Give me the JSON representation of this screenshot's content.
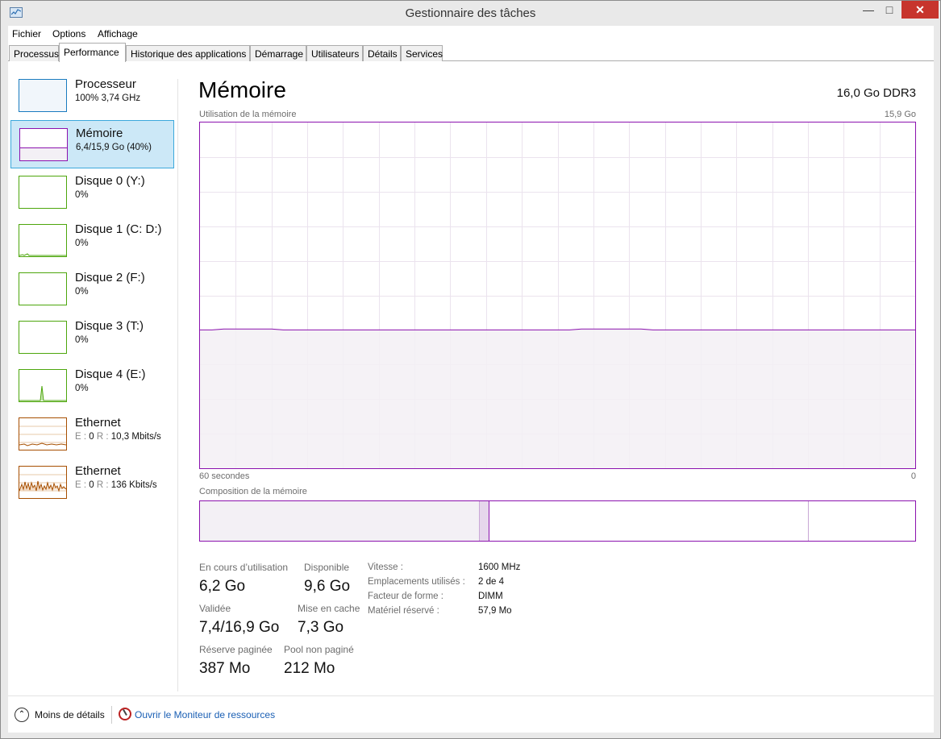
{
  "window": {
    "title": "Gestionnaire des tâches"
  },
  "menu": [
    {
      "label": "Fichier"
    },
    {
      "label": "Options"
    },
    {
      "label": "Affichage"
    }
  ],
  "tabs": [
    {
      "label": "Processus",
      "active": false
    },
    {
      "label": "Performance",
      "active": true
    },
    {
      "label": "Historique des applications",
      "active": false
    },
    {
      "label": "Démarrage",
      "active": false
    },
    {
      "label": "Utilisateurs",
      "active": false
    },
    {
      "label": "Détails",
      "active": false
    },
    {
      "label": "Services",
      "active": false
    }
  ],
  "sidebar": [
    {
      "title": "Processeur",
      "subtitle": "100% 3,74 GHz",
      "color": "#1a7bbf",
      "selected": false
    },
    {
      "title": "Mémoire",
      "subtitle": "6,4/15,9 Go (40%)",
      "color": "#8b12ae",
      "selected": true
    },
    {
      "title": "Disque 0 (Y:)",
      "subtitle": "0%",
      "color": "#4da60c",
      "selected": false
    },
    {
      "title": "Disque 1 (C: D:)",
      "subtitle": "0%",
      "color": "#4da60c",
      "selected": false
    },
    {
      "title": "Disque 2 (F:)",
      "subtitle": "0%",
      "color": "#4da60c",
      "selected": false
    },
    {
      "title": "Disque 3 (T:)",
      "subtitle": "0%",
      "color": "#4da60c",
      "selected": false
    },
    {
      "title": "Disque 4 (E:)",
      "subtitle": "0%",
      "color": "#4da60c",
      "selected": false
    },
    {
      "title": "Ethernet",
      "sub_e": "E :",
      "sub_e_val": "0",
      "sub_r": "R :",
      "sub_r_val": "10,3 Mbits/s",
      "color": "#a74f01",
      "selected": false
    },
    {
      "title": "Ethernet",
      "sub_e": "E :",
      "sub_e_val": "0",
      "sub_r": "R :",
      "sub_r_val": "136 Kbits/s",
      "color": "#a74f01",
      "selected": false
    }
  ],
  "main": {
    "title": "Mémoire",
    "spec": "16,0 Go DDR3",
    "usage_label": "Utilisation de la mémoire",
    "usage_max": "15,9 Go",
    "time_label": "60 secondes",
    "time_end": "0",
    "usage_level": 0.4,
    "composition_label": "Composition de la mémoire",
    "composition": {
      "in_use": 0.39,
      "modified": 0.015,
      "standby": 0.446,
      "free": 0.149
    },
    "accent_color": "#8b12ae",
    "fill_color": "#f3f0f5"
  },
  "stats": [
    {
      "label": "En cours d’utilisation",
      "value": "6,2 Go"
    },
    {
      "label": "Disponible",
      "value": "9,6 Go"
    },
    {
      "label": "Validée",
      "value": "7,4/16,9 Go"
    },
    {
      "label": "Mise en cache",
      "value": "7,3 Go"
    },
    {
      "label": "Réserve paginée",
      "value": "387 Mo"
    },
    {
      "label": "Pool non paginé",
      "value": "212 Mo"
    }
  ],
  "info": [
    {
      "label": "Vitesse :",
      "value": "1600 MHz"
    },
    {
      "label": "Emplacements utilisés :",
      "value": "2 de 4"
    },
    {
      "label": "Facteur de forme :",
      "value": "DIMM"
    },
    {
      "label": "Matériel réservé :",
      "value": "57,9 Mo"
    }
  ],
  "footer": {
    "less_details": "Moins de détails",
    "resource_monitor": "Ouvrir le Moniteur de ressources"
  }
}
